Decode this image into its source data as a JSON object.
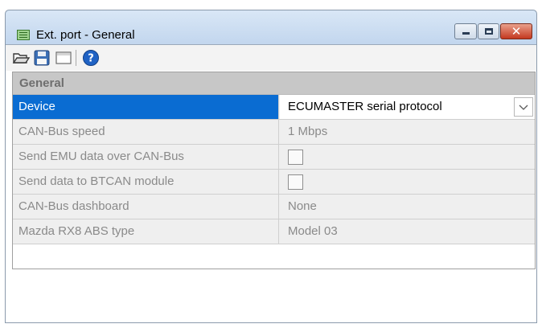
{
  "window": {
    "title": "Ext. port - General",
    "icon": "panel-icon",
    "controls": [
      "minimize",
      "maximize",
      "close"
    ]
  },
  "toolbar": {
    "buttons": [
      {
        "name": "open",
        "icon": "folder-open-icon"
      },
      {
        "name": "save",
        "icon": "floppy-save-icon"
      },
      {
        "name": "blank",
        "icon": "blank-page-icon"
      },
      {
        "name": "help",
        "icon": "help-icon"
      }
    ]
  },
  "grid": {
    "category": "General",
    "rows": [
      {
        "label": "Device",
        "value": "ECUMASTER serial protocol",
        "type": "dropdown",
        "selected": true
      },
      {
        "label": "CAN-Bus speed",
        "value": "1 Mbps",
        "type": "text"
      },
      {
        "label": "Send EMU data over CAN-Bus",
        "value": "",
        "type": "checkbox",
        "checked": false
      },
      {
        "label": "Send data to BTCAN module",
        "value": "",
        "type": "checkbox",
        "checked": false
      },
      {
        "label": "CAN-Bus dashboard",
        "value": "None",
        "type": "text"
      },
      {
        "label": "Mazda RX8 ABS type",
        "value": "Model 03",
        "type": "text"
      }
    ]
  },
  "colors": {
    "selection": "#0a6cd2",
    "category_bg": "#c7c7c7",
    "row_bg": "#efefef",
    "titlebar": "#c5d7ec"
  }
}
